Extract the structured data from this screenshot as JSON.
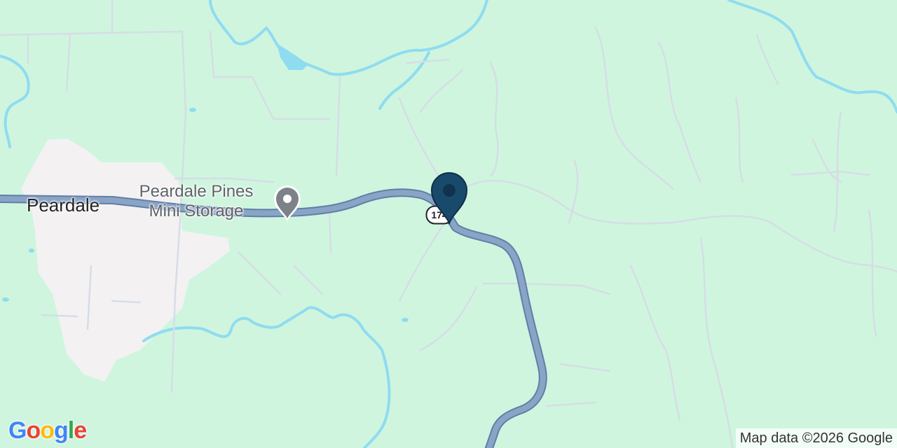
{
  "map": {
    "place_label": "Peardale",
    "poi": {
      "name_line1": "Peardale Pines",
      "name_line2": "Mini Storage",
      "icon": "location-pin-icon"
    },
    "route_shield": {
      "number": "174",
      "icon": "route-shield-icon"
    },
    "selected_marker": {
      "icon": "map-marker-icon",
      "color": "#1a4a6b"
    },
    "colors": {
      "land": "#cff5df",
      "urban_area": "#f4f1f3",
      "highway": "#8aa4c6",
      "water": "#8fdcf0",
      "minor_roads": "#d6dde6"
    }
  },
  "branding": {
    "logo_letters": [
      "G",
      "o",
      "o",
      "g",
      "l",
      "e"
    ],
    "logo_colors": [
      "#4285F4",
      "#EA4335",
      "#FBBC05",
      "#4285F4",
      "#34A853",
      "#EA4335"
    ],
    "attribution": "Map data ©2026 Google"
  }
}
